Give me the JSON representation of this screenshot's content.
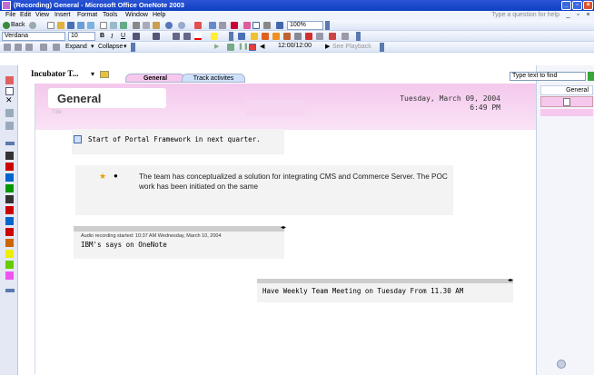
{
  "window": {
    "title": "(Recording) General - Microsoft Office OneNote 2003"
  },
  "menu": {
    "items": [
      "File",
      "Edit",
      "View",
      "Insert",
      "Format",
      "Tools",
      "Window",
      "Help"
    ],
    "question_placeholder": "Type a question for help"
  },
  "toolbar1": {
    "back": "Back",
    "zoom": "100%"
  },
  "toolbar2": {
    "font": "Verdana",
    "size": "10",
    "bold": "B",
    "italic": "I",
    "underline": "U"
  },
  "toolbar3": {
    "expand": "Expand",
    "collapse": "Collapse",
    "time": "12:00/12:00",
    "see_playback": "See Playback"
  },
  "tabs": {
    "notebook": "Incubator T...",
    "sections": [
      "General",
      "Track activites"
    ]
  },
  "find": {
    "placeholder": "Type text to find"
  },
  "page": {
    "title": "General",
    "title_hint": "Title",
    "date": "Tuesday, March 09, 2004",
    "time": "6:49 PM"
  },
  "notes": {
    "note1": "Start of Portal Framework in next quarter.",
    "note2": "The team has conceptualized a solution for integrating CMS and Commerce Server. The POC work has been initiated on the same",
    "audio_meta": "Audio recording started: 10:37 AM Wednesday, March 10, 2004",
    "note3": "IBM's says on OneNote",
    "note4": "Have Weekly Team Meeting on Tuesday  From 11.30 AM"
  },
  "right_pane": {
    "pages": [
      "General"
    ]
  }
}
